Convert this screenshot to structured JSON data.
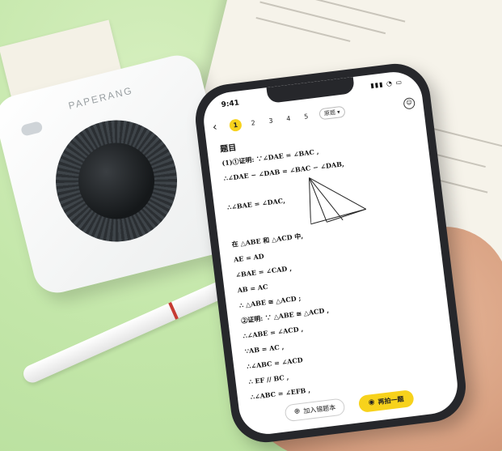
{
  "printer": {
    "brand": "PAPERANG"
  },
  "phone": {
    "status": {
      "time": "9:41",
      "icons": "▮▮▮ ◔ ▭"
    },
    "topbar": {
      "back_icon": "‹",
      "pages": [
        "1",
        "2",
        "3",
        "4",
        "5"
      ],
      "active_page": "1",
      "dropdown_label": "原题 ▾",
      "profile_icon": "☺"
    },
    "content": {
      "heading": "题目",
      "lines": [
        "(1)①证明: ∵∠DAE = ∠BAC ,",
        "∴∠DAE − ∠DAB = ∠BAC − ∠DAB,",
        "∴∠BAE = ∠DAC,",
        "在 △ABE 和 △ACD 中,",
        "AE = AD",
        "∠BAE = ∠CAD ,",
        "AB = AC",
        "∴ △ABE ≅ △ACD ;",
        "②证明: ∵ △ABE ≅ △ACD ,",
        "∴∠ABE = ∠ACD ,",
        "∵AB = AC ,",
        "∴∠ABC = ∠ACD",
        "∴ EF // BC ,",
        "∴∠ABC = ∠EFB ,"
      ]
    },
    "bottom": {
      "add_label": "加入错题本",
      "add_icon": "⊕",
      "retake_label": "再拍一题",
      "retake_icon": "◉"
    }
  }
}
